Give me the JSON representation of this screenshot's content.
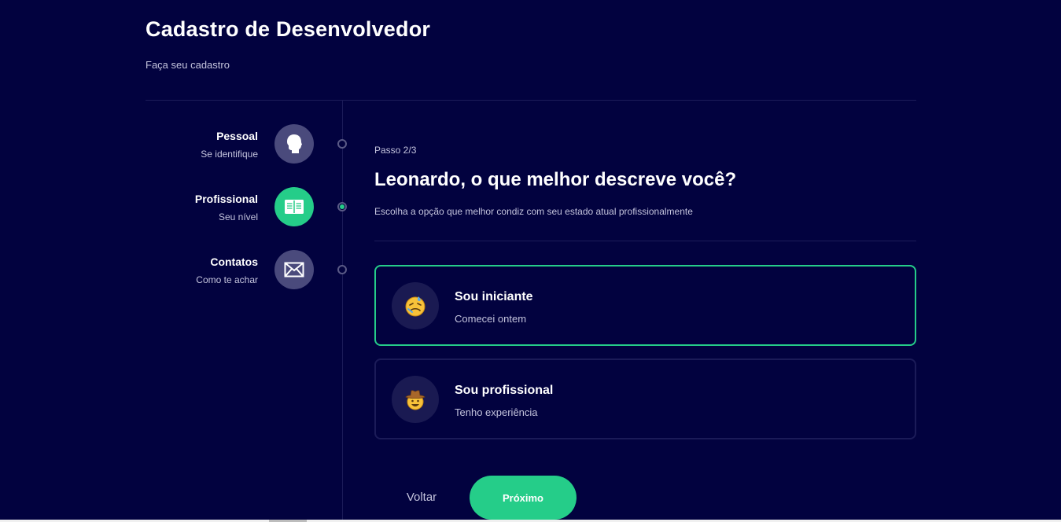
{
  "header": {
    "title": "Cadastro de Desenvolvedor",
    "subtitle": "Faça seu cadastro"
  },
  "steps": [
    {
      "name": "Pessoal",
      "desc": "Se identifique",
      "icon": "user-icon",
      "active": false
    },
    {
      "name": "Profissional",
      "desc": "Seu nível",
      "icon": "book-icon",
      "active": true
    },
    {
      "name": "Contatos",
      "desc": "Como te achar",
      "icon": "mail-icon",
      "active": false
    }
  ],
  "main": {
    "step_label": "Passo 2/3",
    "question": "Leonardo, o que melhor descreve você?",
    "hint": "Escolha a opção que melhor condiz com seu estado atual profissionalmente"
  },
  "options": [
    {
      "title": "Sou iniciante",
      "desc": "Comecei ontem",
      "icon": "face-with-sweat-emoji",
      "selected": true
    },
    {
      "title": "Sou profissional",
      "desc": "Tenho experiência",
      "icon": "cowboy-face-emoji",
      "selected": false
    }
  ],
  "actions": {
    "back_label": "Voltar",
    "next_label": "Próximo"
  },
  "colors": {
    "background": "#02023f",
    "accent": "#25cd89",
    "inactive_circle": "#4a4a7c",
    "divider": "#1b1b58"
  }
}
